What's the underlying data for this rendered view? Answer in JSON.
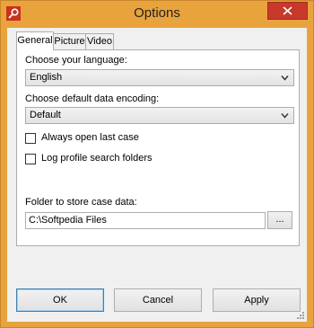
{
  "window": {
    "title": "Options",
    "title_bg_color": "#e9a33d",
    "close_color": "#c7392a",
    "icon": "app-logo-icon"
  },
  "tabs": [
    {
      "label": "General",
      "active": true
    },
    {
      "label": "Picture",
      "active": false
    },
    {
      "label": "Video",
      "active": false
    }
  ],
  "general": {
    "language_label": "Choose your language:",
    "language_value": "English",
    "encoding_label": "Choose default data encoding:",
    "encoding_value": "Default",
    "always_open_label": "Always open last case",
    "always_open_checked": false,
    "log_profile_label": "Log profile search folders",
    "log_profile_checked": false,
    "folder_label": "Folder to store case data:",
    "folder_value": "C:\\Softpedia Files",
    "browse_label": "..."
  },
  "buttons": {
    "ok": "OK",
    "cancel": "Cancel",
    "apply": "Apply"
  }
}
